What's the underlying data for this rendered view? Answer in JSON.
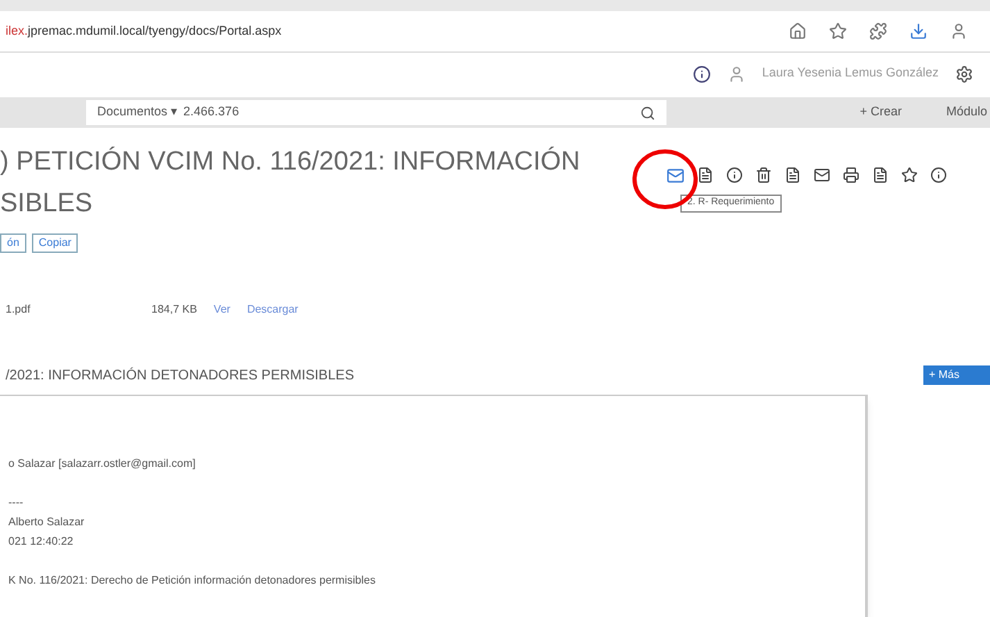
{
  "browser": {
    "url_prefix": "ilex.",
    "url": "jpremac.mdumil.local/tyengy/docs/Portal.aspx"
  },
  "header": {
    "user": "Laura Yesenia Lemus González"
  },
  "search": {
    "scope": "Documentos ▾",
    "value": "2.466.376",
    "create": "+ Crear",
    "modules": "Módulo"
  },
  "document": {
    "title_lines": [
      ") PETICIÓN VCIM No. 116/2021: INFORMACIÓN",
      "SIBLES"
    ],
    "buttons": [
      "ón",
      "Copiar"
    ],
    "toolbar_tooltip": "2. R- Requerimiento",
    "attachment": {
      "name": "1.pdf",
      "size": "184,7 KB",
      "links": [
        "Ver",
        "Descargar"
      ]
    },
    "section_title": "/2021: INFORMACIÓN DETONADORES PERMISIBLES",
    "more_button": "+ Más",
    "email_lines": [
      {
        "kind": "text",
        "text": "o Salazar [salazarr.ostler@gmail.com]"
      },
      {
        "kind": "gap"
      },
      {
        "kind": "text",
        "text": "----"
      },
      {
        "kind": "text",
        "text": "Alberto Salazar"
      },
      {
        "kind": "text",
        "text": "021 12:40:22"
      },
      {
        "kind": "gap"
      },
      {
        "kind": "text",
        "text": "K No. 116/2021: Derecho de Petición información detonadores permisibles"
      }
    ]
  }
}
